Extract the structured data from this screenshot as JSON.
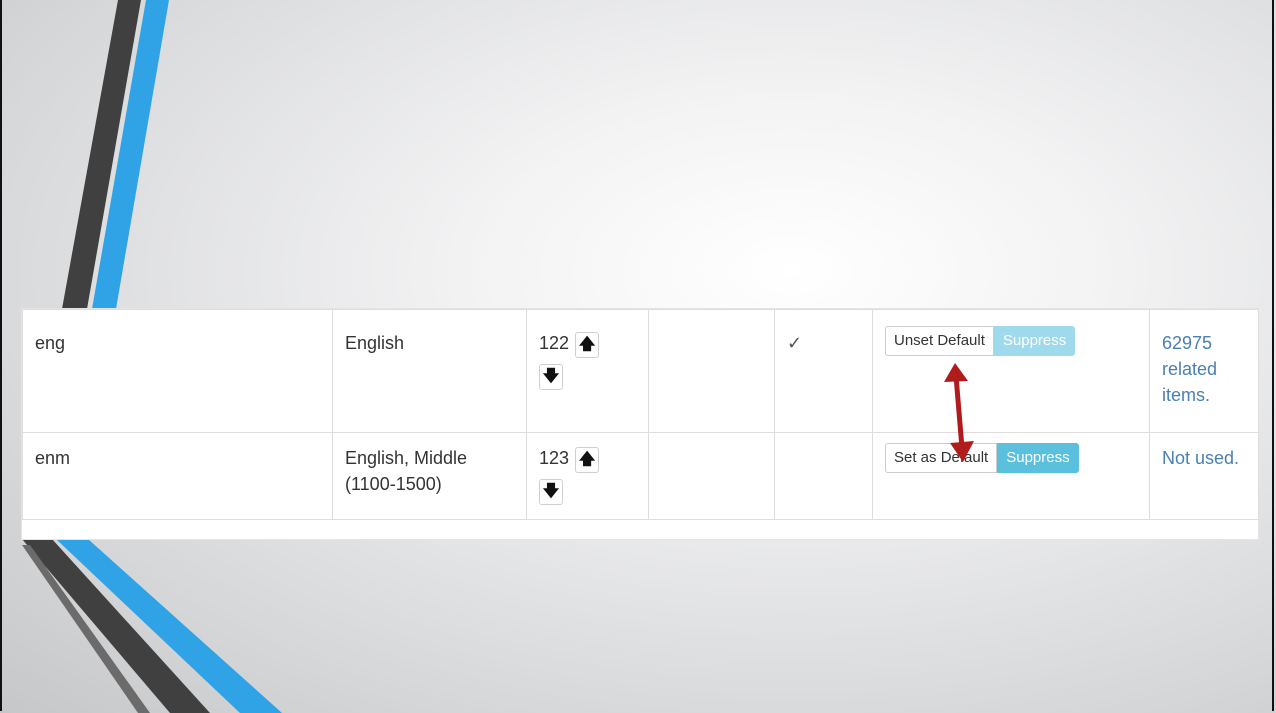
{
  "table": {
    "rows": [
      {
        "code": "eng",
        "name": "English",
        "order": "122",
        "up_icon": "arrow-up-icon",
        "down_icon": "arrow-down-icon",
        "extra": "",
        "default_mark": "✓",
        "toggle_default_label": "Unset Default",
        "suppress_label": "Suppress",
        "usage": "62975 related items."
      },
      {
        "code": "enm",
        "name": "English, Middle (1100-1500)",
        "order": "123",
        "up_icon": "arrow-up-icon",
        "down_icon": "arrow-down-icon",
        "extra": "",
        "default_mark": "",
        "toggle_default_label": "Set as Default",
        "suppress_label": "Suppress",
        "usage": "Not used."
      }
    ]
  },
  "colors": {
    "suppress_active": "#5bc0de",
    "suppress_faded": "#9fd9ec",
    "link": "#4a7fb5",
    "annotation_arrow": "#b01c1c",
    "deco_blue": "#2fa3e6",
    "deco_dark": "#404040"
  },
  "glyphs": {
    "up": "🡅",
    "down": "🡇"
  }
}
